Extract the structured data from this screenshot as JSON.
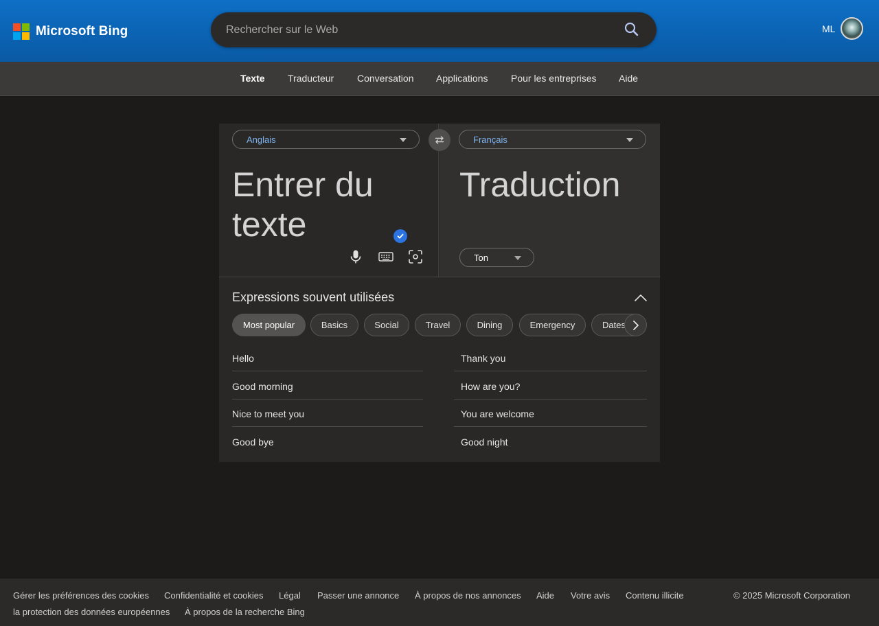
{
  "header": {
    "logo_text": "Microsoft Bing",
    "logo_colors": [
      "#f25022",
      "#7fba00",
      "#00a4ef",
      "#ffb900"
    ],
    "search_placeholder": "Rechercher sur le Web",
    "search_value": "",
    "user_initials": "ML"
  },
  "nav": {
    "items": [
      {
        "label": "Texte",
        "active": true
      },
      {
        "label": "Traducteur",
        "active": false
      },
      {
        "label": "Conversation",
        "active": false
      },
      {
        "label": "Applications",
        "active": false
      },
      {
        "label": "Pour les entreprises",
        "active": false
      },
      {
        "label": "Aide",
        "active": false
      }
    ]
  },
  "translator": {
    "source_language": "Anglais",
    "target_language": "Français",
    "source_placeholder": "Entrer du texte",
    "source_value": "",
    "target_placeholder": "Traduction",
    "tone_label": "Ton",
    "tools": [
      "microphone-icon",
      "keyboard-icon",
      "camera-scan-icon"
    ]
  },
  "phrases": {
    "title": "Expressions souvent utilisées",
    "categories": [
      {
        "label": "Most popular",
        "active": true
      },
      {
        "label": "Basics",
        "active": false
      },
      {
        "label": "Social",
        "active": false
      },
      {
        "label": "Travel",
        "active": false
      },
      {
        "label": "Dining",
        "active": false
      },
      {
        "label": "Emergency",
        "active": false
      },
      {
        "label": "Dates",
        "active": false
      }
    ],
    "left": [
      "Hello",
      "Good morning",
      "Nice to meet you",
      "Good bye"
    ],
    "right": [
      "Thank you",
      "How are you?",
      "You are welcome",
      "Good night"
    ]
  },
  "footer": {
    "links_row1": [
      "Gérer les préférences des cookies",
      "Confidentialité et cookies",
      "Légal",
      "Passer une annonce",
      "À propos de nos annonces",
      "Aide",
      "Votre avis",
      "Contenu illicite"
    ],
    "links_row2": [
      "la protection des données européennes",
      "À propos de la recherche Bing"
    ],
    "copyright": "© 2025 Microsoft Corporation"
  },
  "colors": {
    "header_blue": "#0b63b3",
    "accent_link": "#7fb4f0",
    "check_badge": "#2b73e0"
  }
}
